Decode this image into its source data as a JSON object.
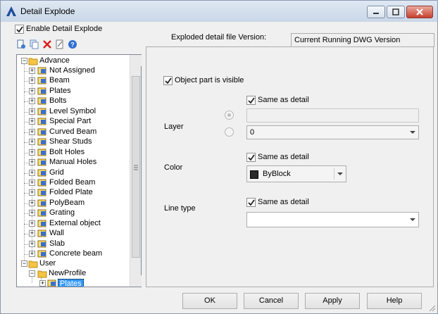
{
  "window": {
    "title": "Detail Explode"
  },
  "enable_checkbox": {
    "label": "Enable Detail Explode",
    "checked": true
  },
  "toolbar": {
    "icons": [
      "new-icon",
      "copy-icon",
      "delete-icon",
      "edit-icon",
      "help-icon"
    ]
  },
  "version": {
    "label": "Exploded detail file Version:",
    "value": "Current Running DWG Version"
  },
  "tree": {
    "root1": "Advance",
    "items": [
      "Not Assigned",
      "Beam",
      "Plates",
      "Bolts",
      "Level Symbol",
      "Special Part",
      "Curved Beam",
      "Shear Studs",
      "Bolt Holes",
      "Manual Holes",
      "Grid",
      "Folded Beam",
      "Folded Plate",
      "PolyBeam",
      "Grating",
      "External object",
      "Wall",
      "Slab",
      "Concrete beam"
    ],
    "root2": "User",
    "profile": "NewProfile",
    "selected": "Plates"
  },
  "object_visible": {
    "label": "Object part is visible",
    "checked": true
  },
  "layer": {
    "label": "Layer",
    "same_label": "Same as detail",
    "same_checked": true,
    "text_value": "",
    "dropdown_value": "0"
  },
  "color": {
    "label": "Color",
    "same_label": "Same as detail",
    "same_checked": true,
    "dropdown_value": "ByBlock"
  },
  "linetype": {
    "label": "Line type",
    "same_label": "Same as detail",
    "same_checked": true,
    "dropdown_value": ""
  },
  "buttons": {
    "ok": "OK",
    "cancel": "Cancel",
    "apply": "Apply",
    "help": "Help"
  }
}
